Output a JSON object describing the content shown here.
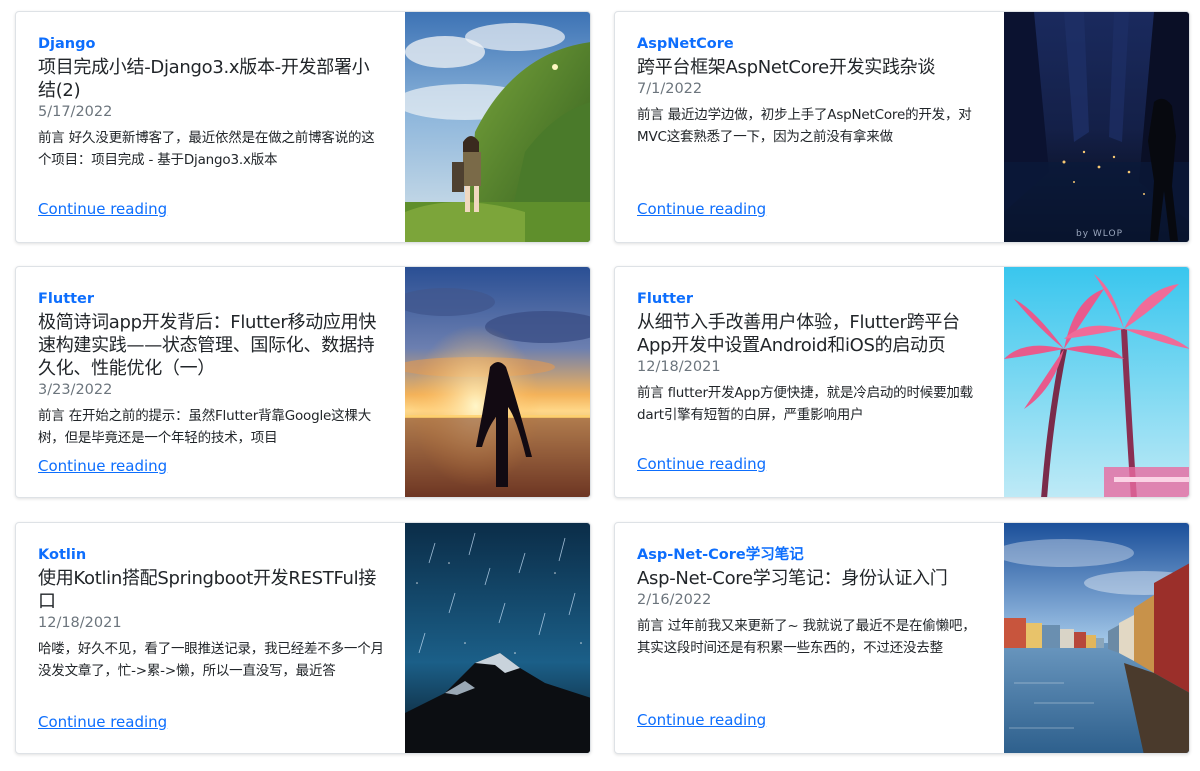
{
  "posts": [
    {
      "category": "Django",
      "title": "项目完成小结-Django3.x版本-开发部署小结(2)",
      "date": "5/17/2022",
      "excerpt": "前言 好久没更新博客了，最近依然是在做之前博客说的这个项目：项目完成 - 基于Django3.x版本",
      "link": "Continue reading",
      "image": "anime-girl-countryside-image"
    },
    {
      "category": "AspNetCore",
      "title": "跨平台框架AspNetCore开发实践杂谈",
      "date": "7/1/2022",
      "excerpt": "前言 最近边学边做，初步上手了AspNetCore的开发，对MVC这套熟悉了一下，因为之前没有拿来做",
      "link": "Continue reading",
      "image": "dark-hall-figure-image"
    },
    {
      "category": "Flutter",
      "title": "极简诗词app开发背后：Flutter移动应用快速构建实践——状态管理、国际化、数据持久化、性能优化（一）",
      "date": "3/23/2022",
      "excerpt": "前言 在开始之前的提示：虽然Flutter背靠Google这棵大树，但是毕竟还是一个年轻的技术，项目",
      "link": "Continue reading",
      "image": "sunset-sea-girl-image"
    },
    {
      "category": "Flutter",
      "title": "从细节入手改善用户体验，Flutter跨平台App开发中设置Android和iOS的启动页",
      "date": "12/18/2021",
      "excerpt": "前言 flutter开发App方便快捷，就是冷启动的时候要加载dart引擎有短暂的白屏，严重影响用户",
      "link": "Continue reading",
      "image": "pink-palm-trees-image"
    },
    {
      "category": "Kotlin",
      "title": "使用Kotlin搭配Springboot开发RESTFul接口",
      "date": "12/18/2021",
      "excerpt": "哈喽，好久不见，看了一眼推送记录，我已经差不多一个月没发文章了，忙->累->懒，所以一直没写，最近答",
      "link": "Continue reading",
      "image": "starry-mountain-image"
    },
    {
      "category": "Asp-Net-Core学习笔记",
      "title": "Asp-Net-Core学习笔记：身份认证入门",
      "date": "2/16/2022",
      "excerpt": "前言 过年前我又来更新了~ 我就说了最近不是在偷懒吧，其实这段时间还是有积累一些东西的，不过还没去整",
      "link": "Continue reading",
      "image": "river-houses-image"
    }
  ],
  "watermark": "by WLOP"
}
